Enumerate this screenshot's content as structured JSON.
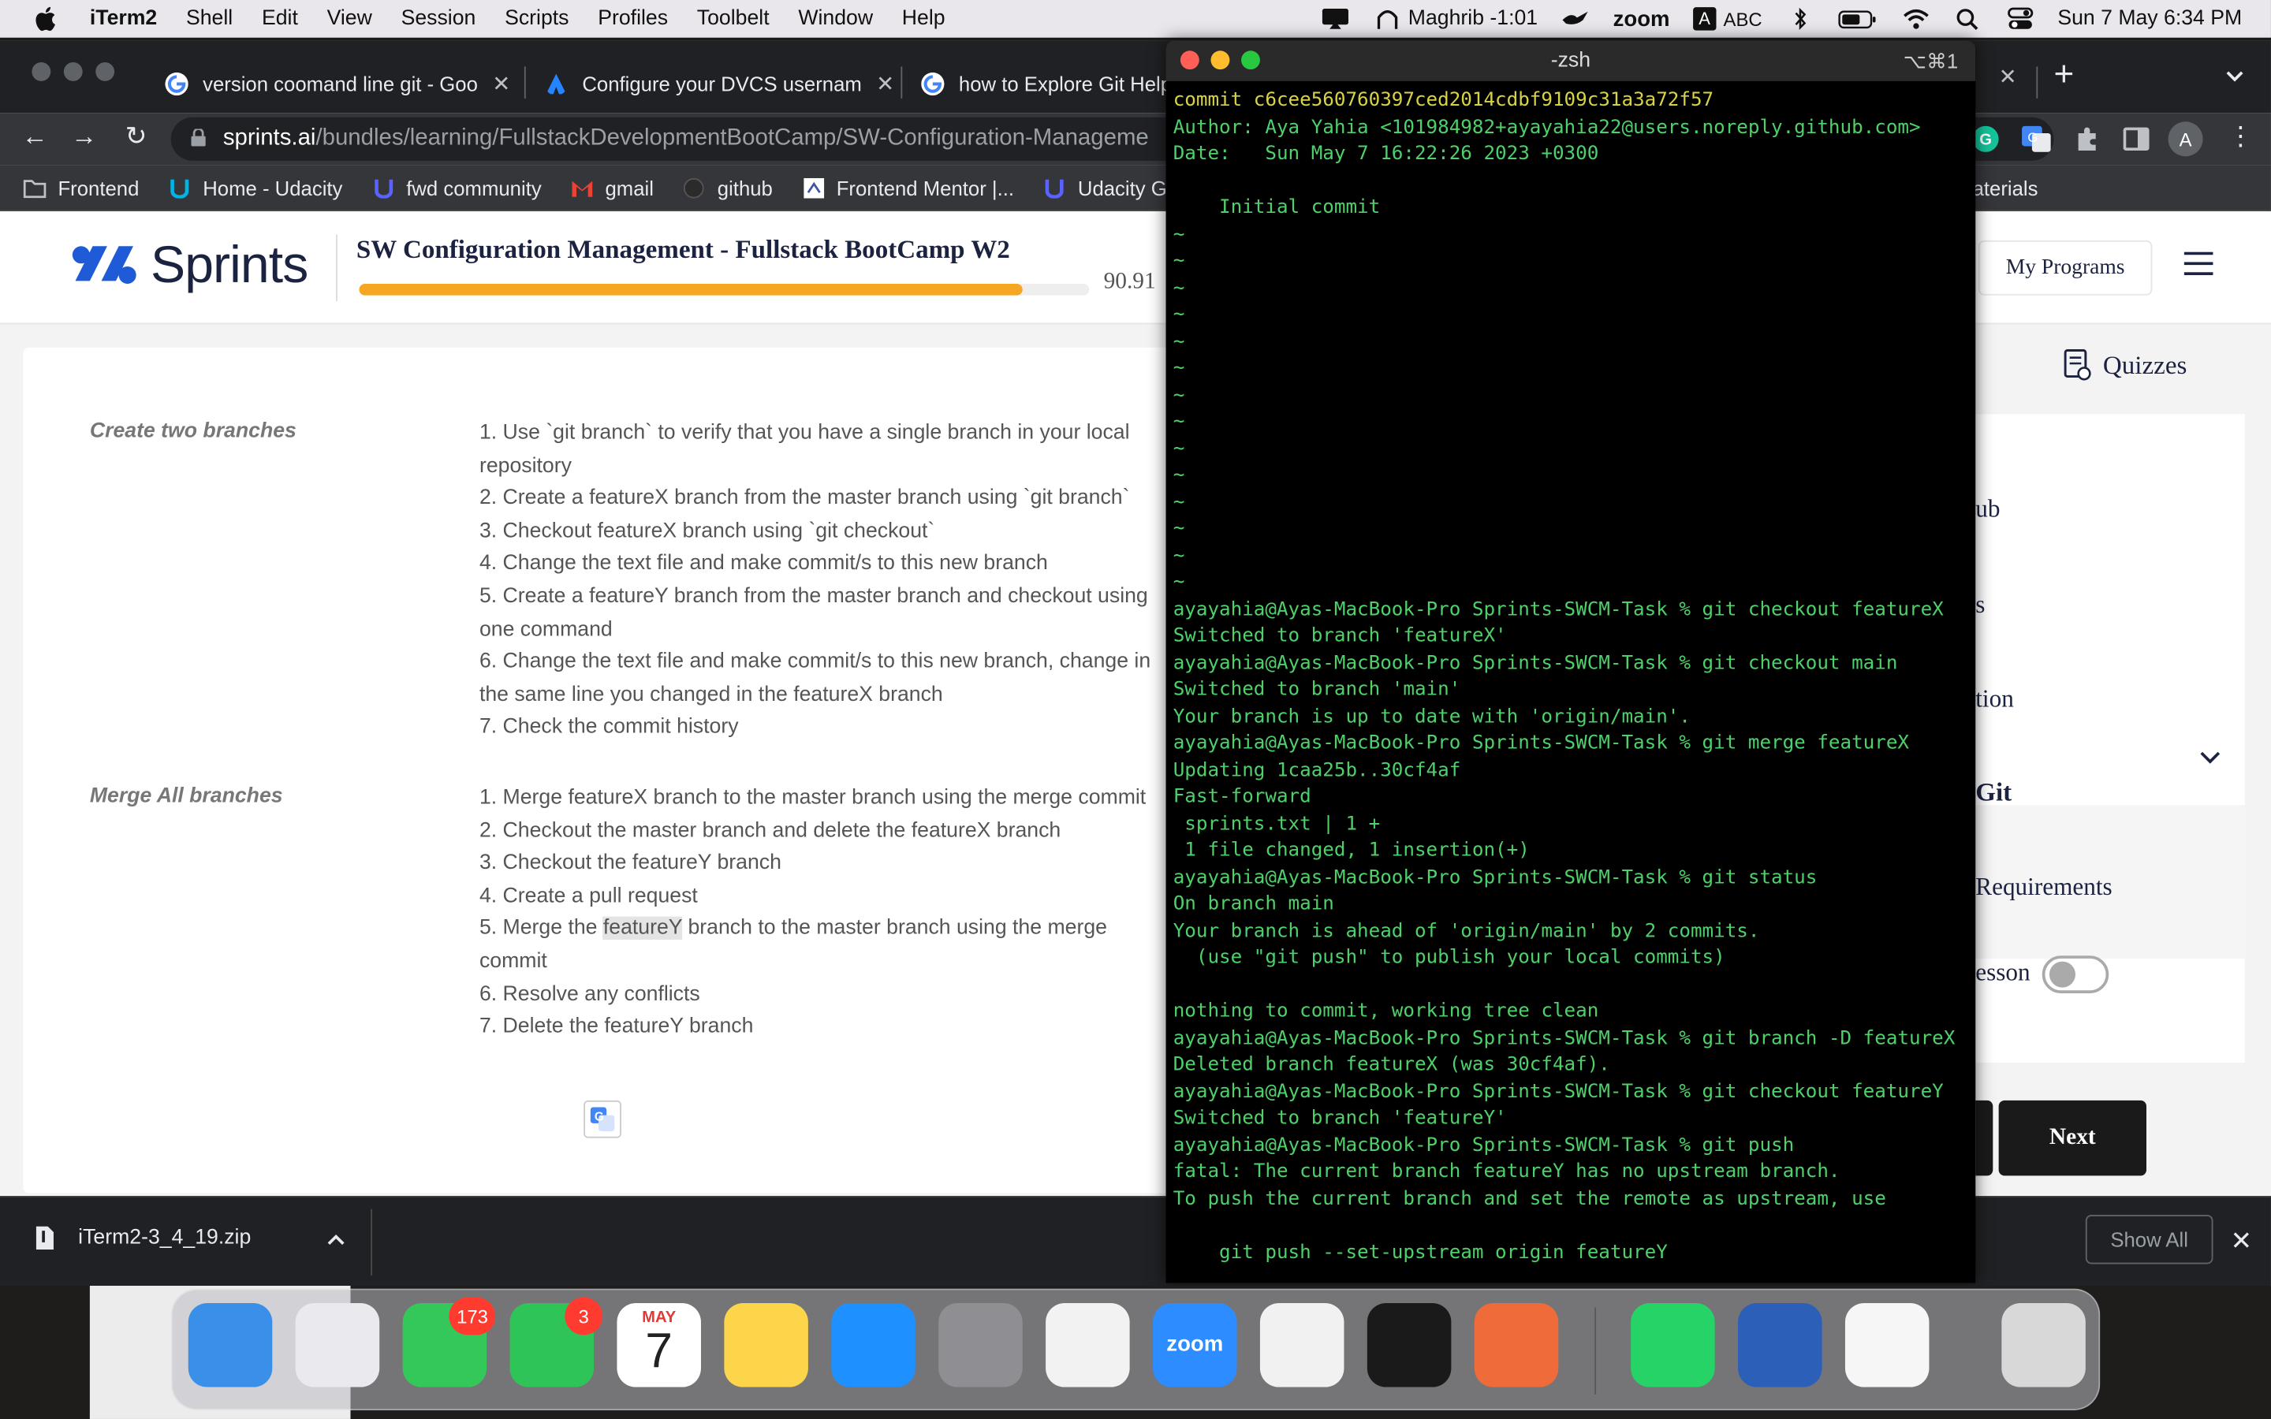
{
  "menubar": {
    "app_name": "iTerm2",
    "items": [
      "Shell",
      "Edit",
      "View",
      "Session",
      "Scripts",
      "Profiles",
      "Toolbelt",
      "Window",
      "Help"
    ],
    "prayer": "Maghrib -1:01",
    "zoom": "zoom",
    "input_source_letter": "A",
    "input_source": "ABC",
    "datetime": "Sun 7 May  6:34 PM"
  },
  "browser": {
    "tabs": [
      {
        "title": "version coomand line git - Goo",
        "icon": "google-icon"
      },
      {
        "title": "Configure your DVCS usernam",
        "icon": "atlassian-icon"
      },
      {
        "title": "how to Explore Git Help",
        "icon": "google-icon"
      }
    ],
    "url_host": "sprints.ai",
    "url_path": "/bundles/learning/FullstackDevelopmentBootCamp/SW-Configuration-Manageme",
    "profile_letter": "A",
    "bookmarks": [
      "Frontend",
      "Home - Udacity",
      "fwd community",
      "gmail",
      "github",
      "Frontend Mentor |...",
      "Udacity G"
    ],
    "bookmark_right": "aterials"
  },
  "page": {
    "logo_text": "Sprints",
    "course_title": "SW Configuration Management - Fullstack BootCamp W2",
    "progress_percent": 90.91,
    "progress_label": "90.91",
    "my_programs": "My Programs",
    "quizzes": "Quizzes",
    "sections": [
      {
        "label": "Create two branches",
        "steps": [
          "1. Use `git branch` to verify that you have a single branch in your local repository",
          "2. Create a featureX branch from the master branch using `git branch`",
          "3. Checkout featureX branch using `git checkout`",
          "4. Change the text file and make commit/s to this new branch",
          "5. Create a featureY branch from the master branch and checkout using one command",
          "6. Change the text file and make commit/s to this new branch, change in the same line you changed in the featureX branch",
          "7. Check the commit history"
        ]
      },
      {
        "label": "Merge All branches",
        "steps": [
          "1. Merge featureX branch to the master branch using the merge commit",
          "2. Checkout the master branch and delete the featureX branch",
          "3. Checkout the featureY branch",
          "4. Create a pull request",
          "5. Merge the ",
          "6. Resolve any conflicts",
          "7. Delete the featureY branch"
        ],
        "step5_highlight": "featureY",
        "step5_rest": " branch to the master branch using the merge commit"
      }
    ],
    "sidebar_items": [
      "ub",
      "s",
      "tion",
      "Git",
      "Requirements",
      "esson"
    ],
    "next_button": "Next"
  },
  "downloads": {
    "file": "iTerm2-3_4_19.zip",
    "show_all": "Show All"
  },
  "terminal": {
    "title": "-zsh",
    "hotkey": "⌥⌘1",
    "lines": [
      {
        "t": "commit c6cee560760397ced2014cdbf9109c31a3a72f57",
        "c": "yel"
      },
      {
        "t": "Author: Aya Yahia <101984982+ayayahia22@users.noreply.github.com>"
      },
      {
        "t": "Date:   Sun May 7 16:22:26 2023 +0300"
      },
      {
        "t": ""
      },
      {
        "t": "    Initial commit"
      },
      {
        "t": "~"
      },
      {
        "t": "~"
      },
      {
        "t": "~"
      },
      {
        "t": "~"
      },
      {
        "t": "~"
      },
      {
        "t": "~"
      },
      {
        "t": "~"
      },
      {
        "t": "~"
      },
      {
        "t": "~"
      },
      {
        "t": "~"
      },
      {
        "t": "~"
      },
      {
        "t": "~"
      },
      {
        "t": "~"
      },
      {
        "t": "~"
      },
      {
        "t": "ayayahia@Ayas-MacBook-Pro Sprints-SWCM-Task % git checkout featureX"
      },
      {
        "t": "Switched to branch 'featureX'"
      },
      {
        "t": "ayayahia@Ayas-MacBook-Pro Sprints-SWCM-Task % git checkout main"
      },
      {
        "t": "Switched to branch 'main'"
      },
      {
        "t": "Your branch is up to date with 'origin/main'."
      },
      {
        "t": "ayayahia@Ayas-MacBook-Pro Sprints-SWCM-Task % git merge featureX"
      },
      {
        "t": "Updating 1caa25b..30cf4af"
      },
      {
        "t": "Fast-forward"
      },
      {
        "t": " sprints.txt | 1 +"
      },
      {
        "t": " 1 file changed, 1 insertion(+)"
      },
      {
        "t": "ayayahia@Ayas-MacBook-Pro Sprints-SWCM-Task % git status"
      },
      {
        "t": "On branch main"
      },
      {
        "t": "Your branch is ahead of 'origin/main' by 2 commits."
      },
      {
        "t": "  (use \"git push\" to publish your local commits)"
      },
      {
        "t": ""
      },
      {
        "t": "nothing to commit, working tree clean"
      },
      {
        "t": "ayayahia@Ayas-MacBook-Pro Sprints-SWCM-Task % git branch -D featureX"
      },
      {
        "t": "Deleted branch featureX (was 30cf4af)."
      },
      {
        "t": "ayayahia@Ayas-MacBook-Pro Sprints-SWCM-Task % git checkout featureY"
      },
      {
        "t": "Switched to branch 'featureY'"
      },
      {
        "t": "ayayahia@Ayas-MacBook-Pro Sprints-SWCM-Task % git push"
      },
      {
        "t": "fatal: The current branch featureY has no upstream branch."
      },
      {
        "t": "To push the current branch and set the remote as upstream, use"
      },
      {
        "t": ""
      },
      {
        "t": "    git push --set-upstream origin featureY"
      }
    ]
  },
  "dock": {
    "apps": [
      {
        "name": "finder-icon",
        "color": "#3a8fe8"
      },
      {
        "name": "launchpad-icon",
        "color": "#e9e9ee"
      },
      {
        "name": "messages-icon",
        "color": "#34c759",
        "badge": "173"
      },
      {
        "name": "facetime-icon",
        "color": "#2fc457",
        "badge": "3"
      },
      {
        "name": "calendar-icon",
        "color": "#ffffff",
        "month": "MAY",
        "day": "7"
      },
      {
        "name": "notes-icon",
        "color": "#fcd54a"
      },
      {
        "name": "app-store-icon",
        "color": "#1e90ff"
      },
      {
        "name": "system-preferences-icon",
        "color": "#8e8e93"
      },
      {
        "name": "vscode-icon",
        "color": "#f2f2f2"
      },
      {
        "name": "zoom-app-icon",
        "color": "#2d8cff",
        "label": "zoom"
      },
      {
        "name": "chrome-icon",
        "color": "#f1f1f1"
      },
      {
        "name": "iterm-icon",
        "color": "#1a1a1a"
      },
      {
        "name": "postman-icon",
        "color": "#ef6c3a"
      },
      {
        "name": "whatsapp-icon",
        "color": "#25d366"
      },
      {
        "name": "word-icon",
        "color": "#2b5fb8"
      },
      {
        "name": "textedit-icon",
        "color": "#f6f6f6"
      },
      {
        "name": "trash-icon",
        "color": "#d8d8d8"
      }
    ]
  },
  "colors": {
    "accent_orange": "#f5a623",
    "terminal_green": "#4ed06a",
    "terminal_yellow": "#d8d248",
    "brand_blue": "#1f5bd6"
  }
}
